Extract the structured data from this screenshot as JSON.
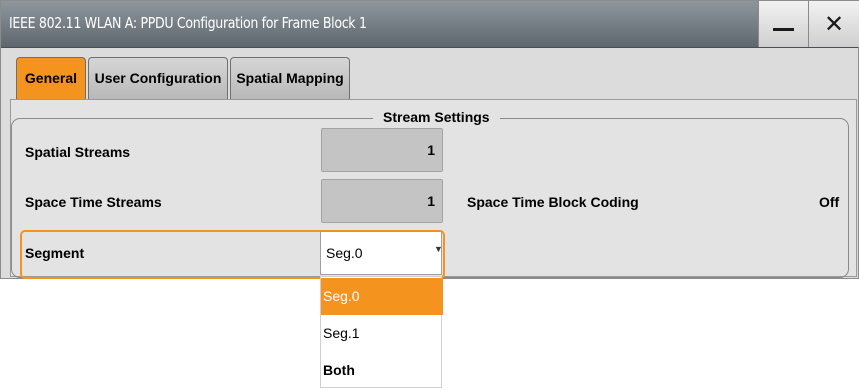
{
  "window": {
    "title": "IEEE 802.11 WLAN A: PPDU Configuration for Frame Block 1",
    "minimize_icon": "minimize-icon",
    "close_icon": "close-icon",
    "close_glyph": "✕"
  },
  "tabs": [
    {
      "label": "General",
      "active": true
    },
    {
      "label": "User Configuration",
      "active": false
    },
    {
      "label": "Spatial Mapping",
      "active": false
    }
  ],
  "section": {
    "title": "Stream Settings"
  },
  "fields": {
    "spatial_streams": {
      "label": "Spatial Streams",
      "value": "1"
    },
    "space_time_streams": {
      "label": "Space Time Streams",
      "value": "1"
    },
    "stbc": {
      "label": "Space Time Block Coding",
      "value": "Off"
    },
    "segment": {
      "label": "Segment",
      "value": "Seg.0",
      "arrow_icon": "dropdown-arrow-icon"
    }
  },
  "dropdown": {
    "options": [
      "Seg.0",
      "Seg.1",
      "Both"
    ],
    "highlighted": "Seg.0"
  },
  "colors": {
    "accent": "#f5931f",
    "titlebar": "#6e767d",
    "readonly_field": "#c4c4c4"
  }
}
